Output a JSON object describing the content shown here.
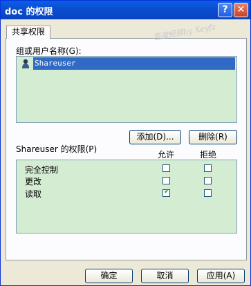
{
  "window": {
    "title": "doc 的权限",
    "help_icon": "?",
    "close_icon": "✕"
  },
  "tab": {
    "label": "共享权限"
  },
  "watermark": "百度经验by Xeyfz",
  "groups_label": "组或用户名称(G):",
  "users": [
    {
      "name": "Shareuser"
    }
  ],
  "buttons": {
    "add": "添加(D)...",
    "remove": "删除(R)",
    "ok": "确定",
    "cancel": "取消",
    "apply": "应用(A)"
  },
  "permissions": {
    "label": "Shareuser 的权限(P)",
    "allow_header": "允许",
    "deny_header": "拒绝",
    "rows": [
      {
        "name": "完全控制",
        "allow": false,
        "deny": false
      },
      {
        "name": "更改",
        "allow": false,
        "deny": false
      },
      {
        "name": "读取",
        "allow": true,
        "deny": false
      }
    ]
  }
}
